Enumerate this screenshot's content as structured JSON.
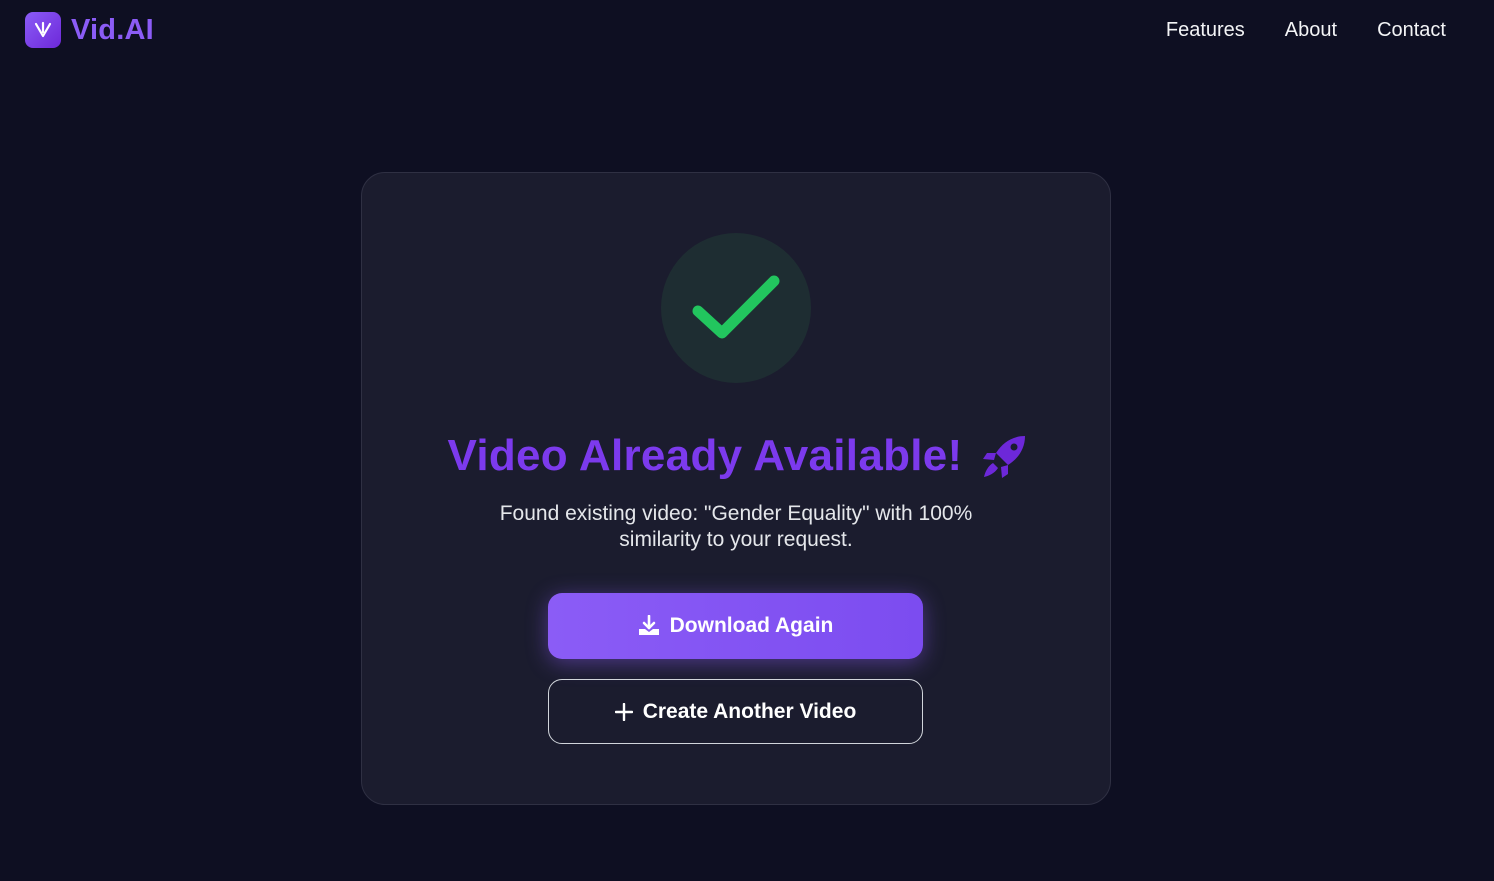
{
  "nav": {
    "brand_name": "Vid.AI",
    "links": [
      {
        "label": "Features"
      },
      {
        "label": "About"
      },
      {
        "label": "Contact"
      }
    ]
  },
  "result": {
    "status_icon": "check-icon",
    "title": "Video Already Available!",
    "title_icon": "rocket-icon",
    "message": "Found existing video: \"Gender Equality\" with 100% similarity to your request.",
    "primary_button": {
      "label": "Download Again",
      "icon": "download-icon"
    },
    "secondary_button": {
      "label": "Create Another Video",
      "icon": "plus-icon"
    }
  },
  "colors": {
    "background": "#0e0f22",
    "card": "#1b1c2e",
    "accent": "#8b5cf6",
    "success": "#22c55e"
  }
}
